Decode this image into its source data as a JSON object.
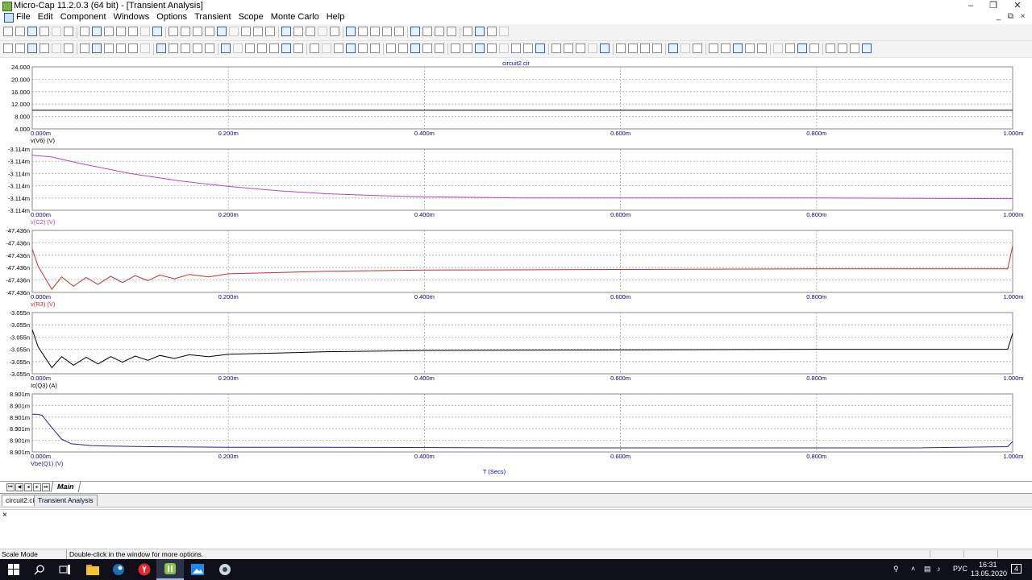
{
  "window": {
    "title": "Micro-Cap 11.2.0.3 (64 bit) - [Transient Analysis]",
    "controls": [
      "–",
      "❐",
      "✕"
    ],
    "mdi_controls": [
      "_",
      "⧉",
      "×"
    ]
  },
  "menu": [
    "File",
    "Edit",
    "Component",
    "Windows",
    "Options",
    "Transient",
    "Scope",
    "Monte Carlo",
    "Help"
  ],
  "plot": {
    "file_title": "circuit2.cir",
    "x_axis_label": "T (Secs)",
    "x_ticks": [
      "0.000m",
      "0.200m",
      "0.400m",
      "0.600m",
      "0.800m",
      "1.000m"
    ]
  },
  "chart_data": [
    {
      "type": "line",
      "series": [
        {
          "name": "v(V6) (V)",
          "x": [
            0,
            1.0
          ],
          "y": [
            10.0,
            10.0
          ]
        }
      ],
      "xlim": [
        0,
        1.0
      ],
      "ylim": [
        4.0,
        24.0
      ],
      "y_ticks": [
        "24.000",
        "20.000",
        "16.000",
        "12.000",
        "8.000",
        "4.000"
      ],
      "color": "#000000"
    },
    {
      "type": "line",
      "series": [
        {
          "name": "v(C2) (V)",
          "x": [
            0,
            0.02,
            0.05,
            0.1,
            0.15,
            0.2,
            0.25,
            0.3,
            0.35,
            0.4,
            0.5,
            0.6,
            0.8,
            1.0
          ],
          "y": [
            0.9,
            0.87,
            0.76,
            0.6,
            0.48,
            0.39,
            0.32,
            0.27,
            0.24,
            0.22,
            0.2,
            0.2,
            0.2,
            0.19
          ]
        }
      ],
      "xlim": [
        0,
        1.0
      ],
      "ylim": [
        0,
        1
      ],
      "y_ticks": [
        "-3.114m",
        "-3.114m",
        "-3.114m",
        "-3.114m",
        "-3.114m",
        "-3.114m"
      ],
      "color": "#c040c0"
    },
    {
      "type": "line",
      "series": [
        {
          "name": "v(R3) (V)",
          "x": [
            0,
            0.006,
            0.02,
            0.03,
            0.042,
            0.055,
            0.067,
            0.08,
            0.092,
            0.105,
            0.118,
            0.13,
            0.145,
            0.16,
            0.18,
            0.2,
            0.25,
            0.3,
            0.4,
            0.6,
            0.8,
            0.995,
            1.0
          ],
          "y": [
            0.7,
            0.42,
            0.05,
            0.25,
            0.1,
            0.24,
            0.13,
            0.26,
            0.16,
            0.27,
            0.19,
            0.28,
            0.22,
            0.29,
            0.25,
            0.3,
            0.32,
            0.34,
            0.36,
            0.37,
            0.38,
            0.38,
            0.75
          ]
        }
      ],
      "xlim": [
        0,
        1.0
      ],
      "ylim": [
        0,
        1
      ],
      "y_ticks": [
        "-47.436n",
        "-47.436n",
        "-47.436n",
        "-47.436n",
        "-47.436n",
        "-47.436n"
      ],
      "color": "#c03030"
    },
    {
      "type": "line",
      "series": [
        {
          "name": "Ic(Q3) (A)",
          "x": [
            0,
            0.006,
            0.02,
            0.03,
            0.042,
            0.055,
            0.067,
            0.08,
            0.092,
            0.105,
            0.118,
            0.13,
            0.145,
            0.16,
            0.18,
            0.2,
            0.25,
            0.3,
            0.4,
            0.6,
            0.8,
            0.995,
            1.0
          ],
          "y": [
            0.72,
            0.44,
            0.1,
            0.28,
            0.14,
            0.27,
            0.16,
            0.28,
            0.19,
            0.29,
            0.22,
            0.3,
            0.25,
            0.31,
            0.28,
            0.32,
            0.34,
            0.36,
            0.38,
            0.39,
            0.4,
            0.4,
            0.66
          ]
        }
      ],
      "xlim": [
        0,
        1.0
      ],
      "ylim": [
        0,
        1
      ],
      "y_ticks": [
        "-3.055n",
        "-3.055n",
        "-3.055n",
        "-3.055n",
        "-3.055n",
        "-3.055n"
      ],
      "color": "#000000"
    },
    {
      "type": "line",
      "series": [
        {
          "name": "Vbe(Q1) (V)",
          "x": [
            0,
            0.005,
            0.01,
            0.02,
            0.03,
            0.04,
            0.06,
            0.08,
            0.12,
            0.2,
            0.3,
            0.5,
            0.7,
            0.9,
            0.995,
            1.0
          ],
          "y": [
            0.65,
            0.65,
            0.63,
            0.42,
            0.22,
            0.14,
            0.11,
            0.1,
            0.09,
            0.08,
            0.08,
            0.07,
            0.07,
            0.07,
            0.09,
            0.18
          ]
        }
      ],
      "xlim": [
        0,
        1.0
      ],
      "ylim": [
        0,
        1
      ],
      "y_ticks": [
        "8.901m",
        "8.901m",
        "8.901m",
        "8.901m",
        "8.901m",
        "8.901m"
      ],
      "color": "#2020a0"
    }
  ],
  "sheet_tab": "Main",
  "doc_tabs": [
    "circuit2.cir",
    "Transient Analysis"
  ],
  "status": {
    "mode": "Scale Mode",
    "hint": "Double-click in the window for more options."
  },
  "taskbar": {
    "time": "16:31",
    "date": "13.05.2020",
    "lang": "РУС",
    "notifications": "4"
  },
  "colors": {
    "grid_dash": "#999999",
    "axis_label": "#0000aa",
    "taskbar": "#0f0f1a"
  }
}
